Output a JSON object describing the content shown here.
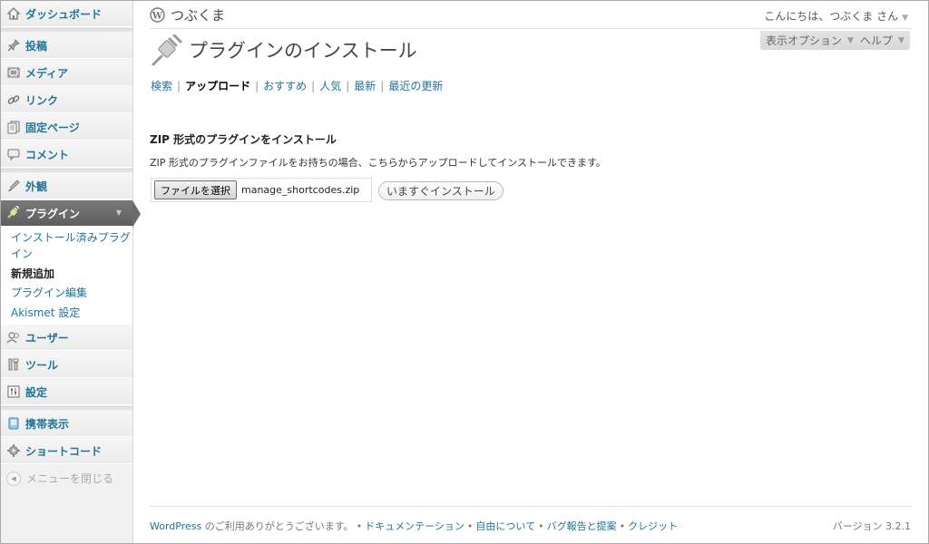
{
  "sidebar": {
    "items": [
      {
        "label": "ダッシュボード",
        "icon": "dashboard-icon"
      },
      {
        "label": "投稿",
        "icon": "pin-icon"
      },
      {
        "label": "メディア",
        "icon": "media-icon"
      },
      {
        "label": "リンク",
        "icon": "link-icon"
      },
      {
        "label": "固定ページ",
        "icon": "pages-icon"
      },
      {
        "label": "コメント",
        "icon": "comment-icon"
      },
      {
        "label": "外観",
        "icon": "appearance-icon"
      },
      {
        "label": "プラグイン",
        "icon": "plugin-icon"
      },
      {
        "label": "ユーザー",
        "icon": "users-icon"
      },
      {
        "label": "ツール",
        "icon": "tools-icon"
      },
      {
        "label": "設定",
        "icon": "settings-icon"
      },
      {
        "label": "携帯表示",
        "icon": "mobile-icon"
      },
      {
        "label": "ショートコード",
        "icon": "gear-icon"
      }
    ],
    "submenu": [
      {
        "label": "インストール済みプラグイン"
      },
      {
        "label": "新規追加"
      },
      {
        "label": "プラグイン編集"
      },
      {
        "label": "Akismet 設定"
      }
    ],
    "submenu_line1": "インストール済みプラグ",
    "submenu_line2": "イン",
    "collapse_label": "メニューを閉じる"
  },
  "header": {
    "site_title": "つぶくま",
    "greeting": "こんにちは、つぶくま さん",
    "screen_options": "表示オプション",
    "help": "ヘルプ"
  },
  "main": {
    "title": "プラグインのインストール",
    "subnav": [
      "検索",
      "アップロード",
      "おすすめ",
      "人気",
      "最新",
      "最近の更新"
    ],
    "section_title": "ZIP 形式のプラグインをインストール",
    "section_desc": "ZIP 形式のプラグインファイルをお持ちの場合、こちらからアップロードしてインストールできます。",
    "file_button": "ファイルを選択",
    "file_name": "manage_shortcodes.zip",
    "install_button": "いますぐインストール"
  },
  "footer": {
    "thanks_link": "WordPress",
    "thanks_text": " のご利用ありがとうございます。",
    "links": [
      "ドキュメンテーション",
      "自由について",
      "バグ報告と提案",
      "クレジット"
    ],
    "version": "バージョン 3.2.1"
  },
  "colors": {
    "link": "#21759b",
    "active_menu": "#6b6b6b"
  }
}
